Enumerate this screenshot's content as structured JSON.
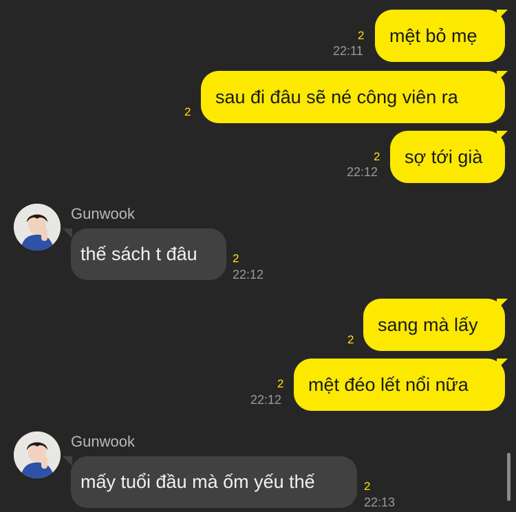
{
  "messages": [
    {
      "id": "m1",
      "sender": "me",
      "text": "mệt bỏ mẹ",
      "unread": "2",
      "time": "22:11"
    },
    {
      "id": "m2",
      "sender": "me",
      "text": "sau đi đâu sẽ né công viên ra",
      "unread": "2",
      "time": ""
    },
    {
      "id": "m3",
      "sender": "me",
      "text": "sợ tới già",
      "unread": "2",
      "time": "22:12"
    },
    {
      "id": "m4",
      "sender": "them",
      "name": "Gunwook",
      "text": "thế sách t đâu",
      "unread": "2",
      "time": "22:12"
    },
    {
      "id": "m5",
      "sender": "me",
      "text": "sang mà lấy",
      "unread": "2",
      "time": ""
    },
    {
      "id": "m6",
      "sender": "me",
      "text": "mệt đéo lết nổi nữa",
      "unread": "2",
      "time": "22:12"
    },
    {
      "id": "m7",
      "sender": "them",
      "name": "Gunwook",
      "text": "mấy tuổi đầu mà ốm yếu thế",
      "unread": "2",
      "time": "22:13"
    }
  ],
  "colors": {
    "my_bubble": "#fde800",
    "their_bubble": "#414141",
    "background": "#262626",
    "unread": "#ffe400"
  },
  "icons": {
    "avatar": "profile-photo"
  }
}
